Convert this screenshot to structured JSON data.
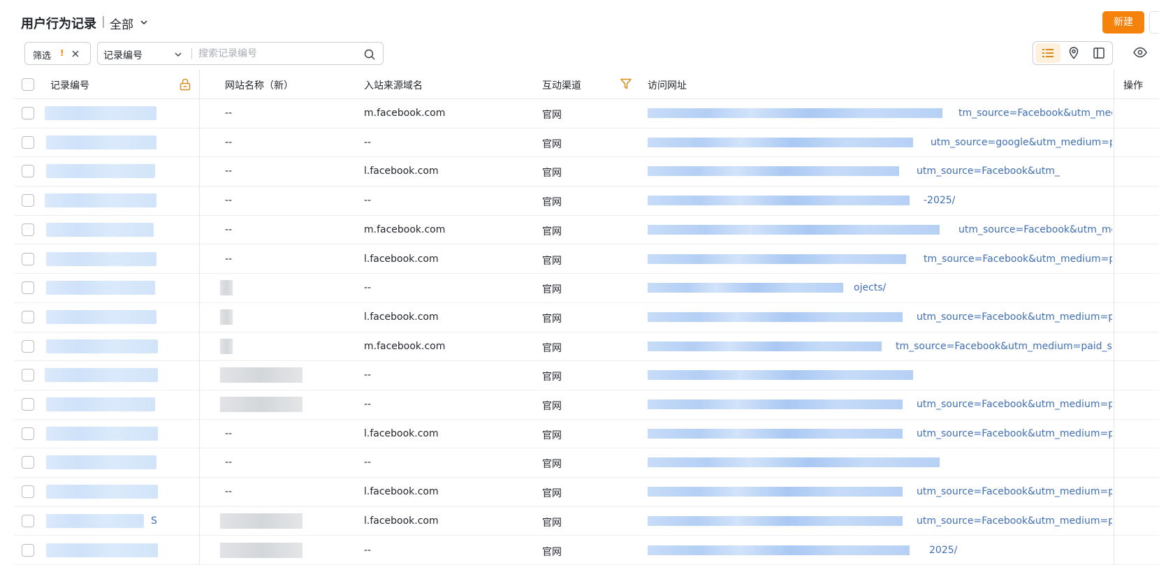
{
  "header": {
    "title": "用户行为记录",
    "separator": "|",
    "view_name": "全部",
    "new_button": "新建"
  },
  "toolbar": {
    "filter_label": "筛选",
    "filter_warning": "!",
    "search_field": "记录编号",
    "search_placeholder": "搜索记录编号"
  },
  "columns": {
    "record_id": "记录编号",
    "site_name": "网站名称（新）",
    "source_domain": "入站来源域名",
    "channel": "互动渠道",
    "url": "访问网址",
    "actions": "操作"
  },
  "rows": [
    {
      "site": "--",
      "domain": "m.facebook.com",
      "channel": "官网",
      "url_tail": "tm_source=Facebook&utm_mediu"
    },
    {
      "site": "--",
      "domain": "--",
      "channel": "官网",
      "url_tail": "utm_source=google&utm_medium=paid&ut"
    },
    {
      "site": "--",
      "domain": "l.facebook.com",
      "channel": "官网",
      "url_tail": "utm_source=Facebook&utm_"
    },
    {
      "site": "--",
      "domain": "--",
      "channel": "官网",
      "url_tail": "-2025/"
    },
    {
      "site": "--",
      "domain": "m.facebook.com",
      "channel": "官网",
      "url_tail": "utm_source=Facebook&utm_mediu"
    },
    {
      "site": "--",
      "domain": "l.facebook.com",
      "channel": "官网",
      "url_tail": "tm_source=Facebook&utm_medium=paid_s"
    },
    {
      "site": "",
      "domain": "--",
      "channel": "官网",
      "url_tail": "ojects/"
    },
    {
      "site": "",
      "domain": "l.facebook.com",
      "channel": "官网",
      "url_tail": "utm_source=Facebook&utm_medium=paid_s"
    },
    {
      "site": "",
      "domain": "m.facebook.com",
      "channel": "官网",
      "url_tail": "tm_source=Facebook&utm_medium=paid_social"
    },
    {
      "site": "",
      "domain": "--",
      "channel": "官网",
      "url_tail": ""
    },
    {
      "site": "",
      "domain": "--",
      "channel": "官网",
      "url_tail": "utm_source=Facebook&utm_medium=paid_s"
    },
    {
      "site": "--",
      "domain": "l.facebook.com",
      "channel": "官网",
      "url_tail": "utm_source=Facebook&utm_medium=paid_s"
    },
    {
      "site": "--",
      "domain": "--",
      "channel": "官网",
      "url_tail": ""
    },
    {
      "site": "--",
      "domain": "l.facebook.com",
      "channel": "官网",
      "url_tail": "utm_source=Facebook&utm_medium=paid_s"
    },
    {
      "site": "",
      "domain": "l.facebook.com",
      "channel": "官网",
      "url_tail": "utm_source=Facebook&utm_medium=paid_s"
    },
    {
      "site": "",
      "domain": "--",
      "channel": "官网",
      "url_tail": "2025/"
    }
  ],
  "row14_id_suffix": "S",
  "colors": {
    "accent": "#f5820a",
    "link": "#3f6fb5",
    "border": "#c9cdd4"
  },
  "icons": [
    "chevron-down-icon",
    "close-icon",
    "search-icon",
    "list-view-icon",
    "map-pin-icon",
    "panel-view-icon",
    "eye-icon",
    "lock-icon",
    "filter-icon"
  ]
}
